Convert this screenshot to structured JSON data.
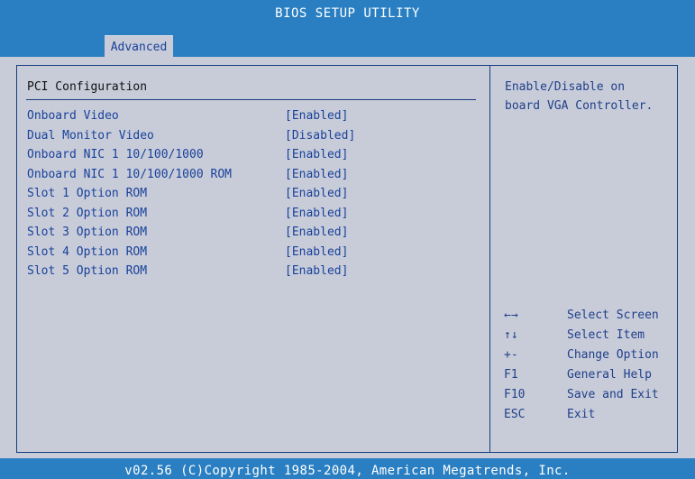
{
  "header": {
    "title": "BIOS SETUP UTILITY"
  },
  "tabs": [
    {
      "label": "Advanced",
      "active": true
    }
  ],
  "section": {
    "title": "PCI Configuration",
    "settings": [
      {
        "label": "Onboard Video",
        "value": "[Enabled]"
      },
      {
        "label": "Dual Monitor Video",
        "value": "[Disabled]"
      },
      {
        "label": "Onboard NIC 1 10/100/1000",
        "value": "[Enabled]"
      },
      {
        "label": "Onboard NIC 1 10/100/1000 ROM",
        "value": "[Enabled]"
      },
      {
        "label": "Slot 1 Option ROM",
        "value": "[Enabled]"
      },
      {
        "label": "Slot 2 Option ROM",
        "value": "[Enabled]"
      },
      {
        "label": "Slot 3 Option ROM",
        "value": "[Enabled]"
      },
      {
        "label": "Slot 4 Option ROM",
        "value": "[Enabled]"
      },
      {
        "label": "Slot 5 Option ROM",
        "value": "[Enabled]"
      }
    ]
  },
  "help": {
    "lines": [
      "Enable/Disable on",
      "board VGA Controller."
    ]
  },
  "keys": [
    {
      "key": "←→",
      "desc": "Select Screen"
    },
    {
      "key": "↑↓",
      "desc": "Select Item"
    },
    {
      "key": "+-",
      "desc": "Change Option"
    },
    {
      "key": "F1",
      "desc": "General Help"
    },
    {
      "key": "F10",
      "desc": "Save and Exit"
    },
    {
      "key": "ESC",
      "desc": "Exit"
    }
  ],
  "footer": {
    "text": "v02.56 (C)Copyright 1985-2004, American Megatrends, Inc."
  },
  "colors": {
    "bar": "#2a7fc2",
    "panel": "#c8ccd9",
    "item_text": "#18419a",
    "border": "#163d7e"
  }
}
